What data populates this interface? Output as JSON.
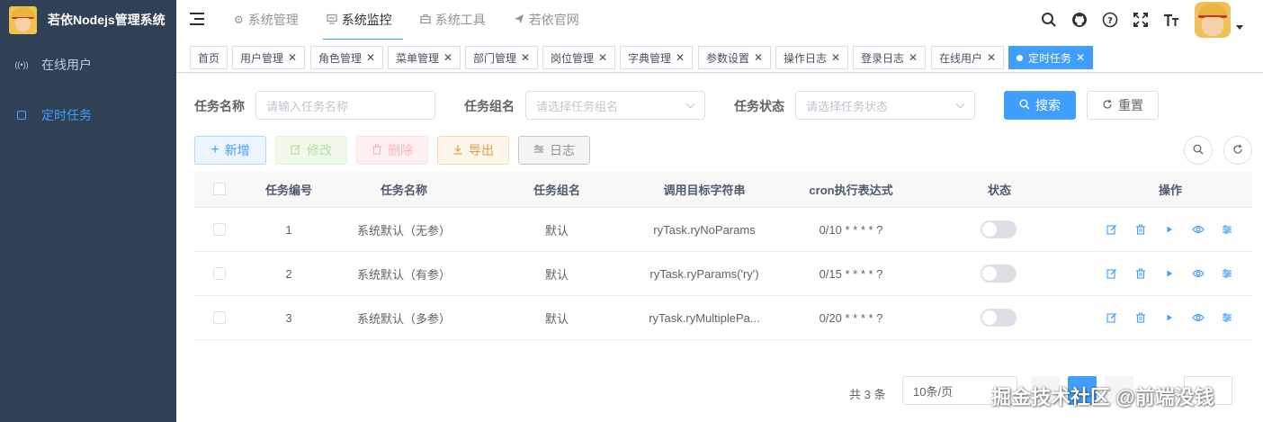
{
  "app": {
    "title": "若依Nodejs管理系统"
  },
  "sidebar": {
    "items": [
      {
        "label": "在线用户",
        "icon": "online-icon",
        "active": false
      },
      {
        "label": "定时任务",
        "icon": "job-icon",
        "active": true
      }
    ]
  },
  "topnav": {
    "items": [
      {
        "label": "系统管理",
        "icon": "gear-icon",
        "active": false
      },
      {
        "label": "系统监控",
        "icon": "monitor-icon",
        "active": true
      },
      {
        "label": "系统工具",
        "icon": "toolbox-icon",
        "active": false
      },
      {
        "label": "若依官网",
        "icon": "send-icon",
        "active": false
      }
    ]
  },
  "tags": [
    {
      "label": "首页",
      "closable": false
    },
    {
      "label": "用户管理",
      "closable": true
    },
    {
      "label": "角色管理",
      "closable": true
    },
    {
      "label": "菜单管理",
      "closable": true
    },
    {
      "label": "部门管理",
      "closable": true
    },
    {
      "label": "岗位管理",
      "closable": true
    },
    {
      "label": "字典管理",
      "closable": true
    },
    {
      "label": "参数设置",
      "closable": true
    },
    {
      "label": "操作日志",
      "closable": true
    },
    {
      "label": "登录日志",
      "closable": true
    },
    {
      "label": "在线用户",
      "closable": true
    },
    {
      "label": "定时任务",
      "closable": true,
      "active": true
    }
  ],
  "search": {
    "job_name_label": "任务名称",
    "job_name_placeholder": "请输入任务名称",
    "job_group_label": "任务组名",
    "job_group_placeholder": "请选择任务组名",
    "status_label": "任务状态",
    "status_placeholder": "请选择任务状态",
    "search_button": "搜索",
    "reset_button": "重置"
  },
  "toolbar": {
    "add": "新增",
    "edit": "修改",
    "delete": "删除",
    "export": "导出",
    "log": "日志"
  },
  "table": {
    "headers": [
      "任务编号",
      "任务名称",
      "任务组名",
      "调用目标字符串",
      "cron执行表达式",
      "状态",
      "操作"
    ],
    "rows": [
      {
        "id": "1",
        "name": "系统默认（无参）",
        "group": "默认",
        "target": "ryTask.ryNoParams",
        "cron": "0/10 * * * * ?",
        "enabled": false
      },
      {
        "id": "2",
        "name": "系统默认（有参）",
        "group": "默认",
        "target": "ryTask.ryParams('ry')",
        "cron": "0/15 * * * * ?",
        "enabled": false
      },
      {
        "id": "3",
        "name": "系统默认（多参）",
        "group": "默认",
        "target": "ryTask.ryMultiplePa...",
        "cron": "0/20 * * * * ?",
        "enabled": false
      }
    ]
  },
  "pagination": {
    "total": "共 3 条",
    "page_size": "10条/页",
    "current_page": 1
  },
  "watermark": "掘金技术社区 @前端没钱",
  "colors": {
    "primary": "#409eff",
    "sidebar_bg": "#304156"
  }
}
